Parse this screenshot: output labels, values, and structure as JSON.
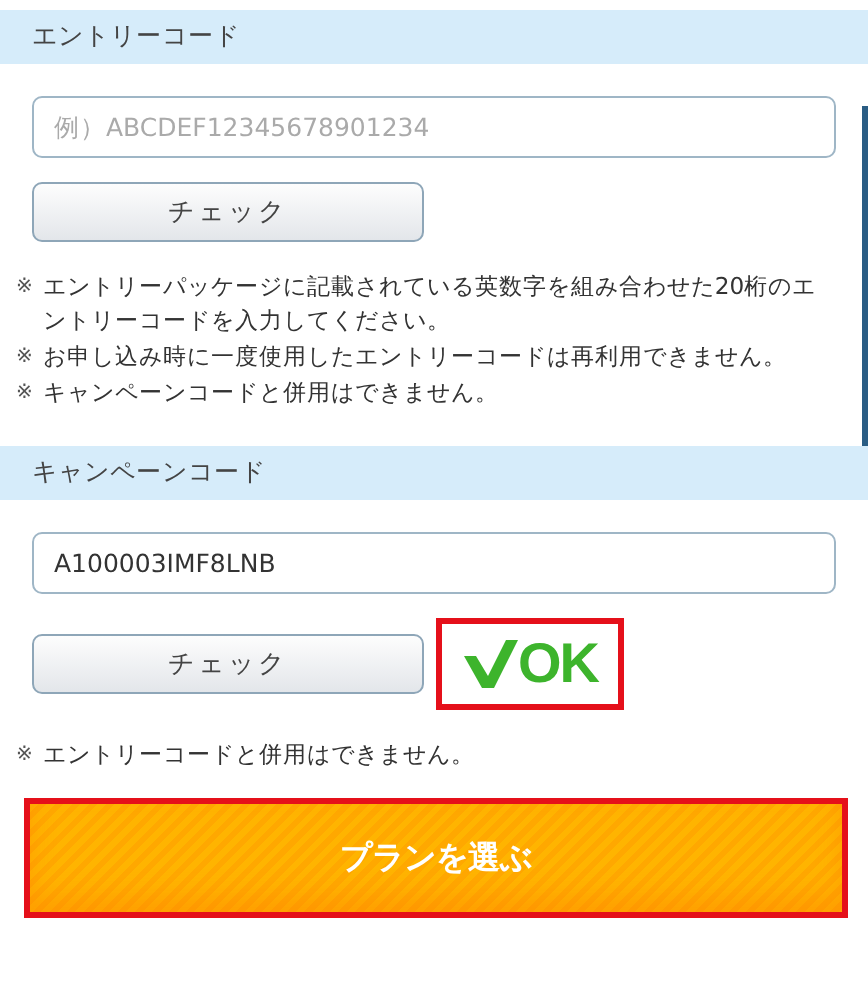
{
  "sections": [
    {
      "title": "エントリーコード",
      "field": {
        "placeholder": "例）ABCDEF12345678901234"
      },
      "check_button": "チェック",
      "notes": [
        {
          "mark": "※",
          "text": "エントリーパッケージに記載されている英数字を組み合わせた20桁のエントリーコードを入力してください。"
        },
        {
          "mark": "※",
          "text": "お申し込み時に一度使用したエントリーコードは再利用できません。"
        },
        {
          "mark": "※",
          "text": "キャンペーンコードと併用はできません。"
        }
      ]
    },
    {
      "title": "キャンペーンコード",
      "field": {
        "value": "A100003IMF8LNB"
      },
      "check_button": "チェック",
      "result": {
        "text": "OK",
        "highlighted": true
      },
      "notes": [
        {
          "mark": "※",
          "text": "エントリーコードと併用はできません。"
        }
      ]
    }
  ],
  "submit": {
    "label": "プランを選ぶ",
    "highlighted": true
  }
}
